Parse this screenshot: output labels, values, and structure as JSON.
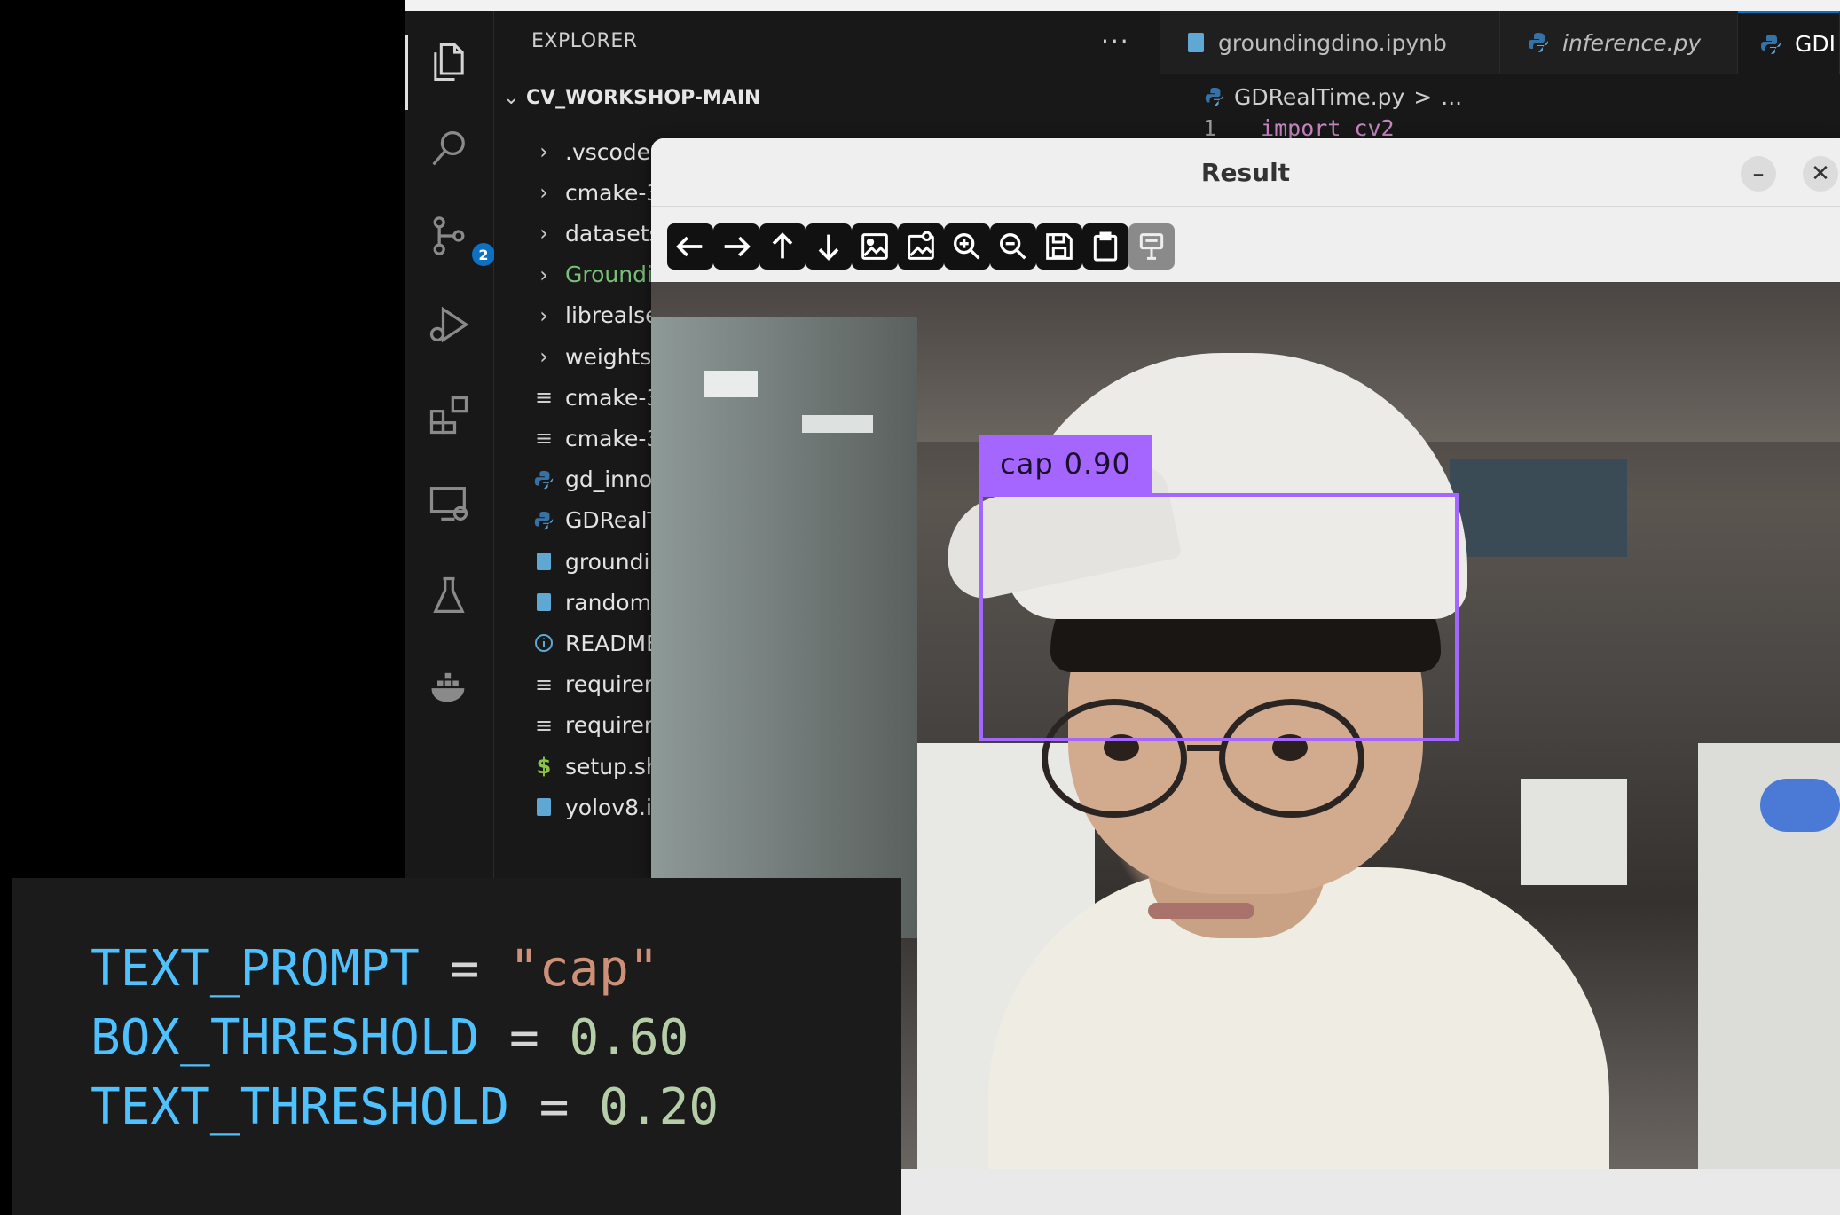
{
  "vscode": {
    "explorer_title": "EXPLORER",
    "more": "···",
    "scm_badge": "2",
    "root_folder": "CV_WORKSHOP-MAIN",
    "tree": [
      {
        "label": ".vscode",
        "kind": "folder"
      },
      {
        "label": "cmake-3",
        "kind": "folder"
      },
      {
        "label": "datasets",
        "kind": "folder"
      },
      {
        "label": "Groundi",
        "kind": "folder",
        "color": "#79c078"
      },
      {
        "label": "librealse",
        "kind": "folder"
      },
      {
        "label": "weights",
        "kind": "folder"
      },
      {
        "label": "cmake-3",
        "kind": "text-file"
      },
      {
        "label": "cmake-3",
        "kind": "text-file"
      },
      {
        "label": "gd_inno:",
        "kind": "python-file"
      },
      {
        "label": "GDRealT",
        "kind": "python-file"
      },
      {
        "label": "groundir",
        "kind": "notebook-file"
      },
      {
        "label": "random_",
        "kind": "notebook-file"
      },
      {
        "label": "README",
        "kind": "info-file"
      },
      {
        "label": "requiren",
        "kind": "text-file"
      },
      {
        "label": "requiren",
        "kind": "text-file"
      },
      {
        "label": "setup.sh",
        "kind": "shell-file"
      },
      {
        "label": "yolov8.ip",
        "kind": "notebook-file"
      }
    ],
    "tabs": [
      {
        "label": "groundingdino.ipynb",
        "icon": "notebook-icon"
      },
      {
        "label": "inference.py",
        "icon": "python-icon"
      },
      {
        "label": "GDI",
        "icon": "python-icon"
      }
    ],
    "breadcrumb": {
      "file": "GDRealTime.py",
      "sep": ">",
      "rest": "..."
    },
    "code_line": {
      "number": "1",
      "code": "import cv2"
    }
  },
  "result_window": {
    "title": "Result",
    "minimize": "–",
    "close": "✕",
    "toolbar": [
      {
        "name": "back-button",
        "icon": "arrow-left-icon"
      },
      {
        "name": "forward-button",
        "icon": "arrow-right-icon"
      },
      {
        "name": "up-button",
        "icon": "arrow-up-icon"
      },
      {
        "name": "down-button",
        "icon": "arrow-down-icon"
      },
      {
        "name": "image-button",
        "icon": "image-icon"
      },
      {
        "name": "image-properties-button",
        "icon": "image-properties-icon"
      },
      {
        "name": "zoom-in-button",
        "icon": "zoom-in-icon"
      },
      {
        "name": "zoom-out-button",
        "icon": "zoom-out-icon"
      },
      {
        "name": "save-button",
        "icon": "save-icon"
      },
      {
        "name": "clipboard-button",
        "icon": "clipboard-icon"
      },
      {
        "name": "properties-button",
        "icon": "settings-icon"
      }
    ],
    "detection": {
      "label": "cap",
      "score": "0.90",
      "color": "#a566ff"
    }
  },
  "code_overlay": {
    "lines": [
      {
        "var": "TEXT_PROMPT",
        "op": " = ",
        "value": "\"cap\"",
        "value_type": "string"
      },
      {
        "var": "BOX_THRESHOLD",
        "op": " = ",
        "value": "0.60",
        "value_type": "number"
      },
      {
        "var": "TEXT_THRESHOLD",
        "op": " = ",
        "value": "0.20",
        "value_type": "number"
      }
    ]
  }
}
